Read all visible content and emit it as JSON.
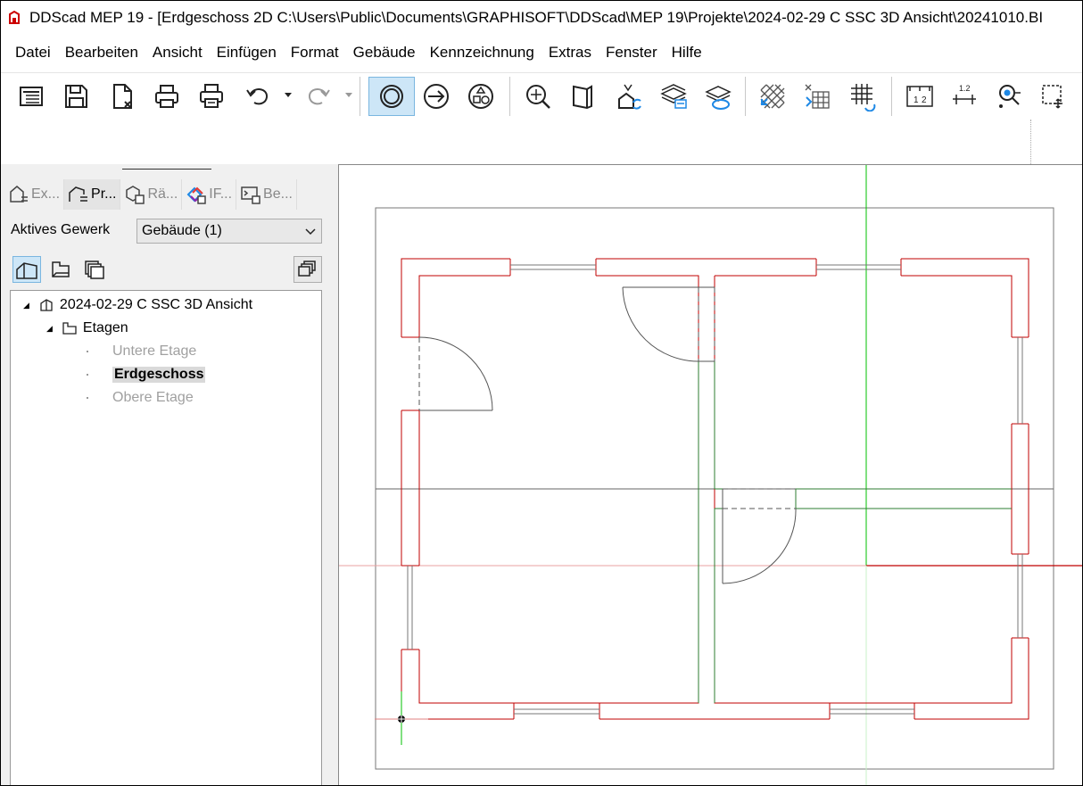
{
  "window": {
    "title": "DDScad MEP 19 - [Erdgeschoss  2D  C:\\Users\\Public\\Documents\\GRAPHISOFT\\DDScad\\MEP 19\\Projekte\\2024-02-29 C SSC 3D Ansicht\\20241010.BI"
  },
  "menu": [
    "Datei",
    "Bearbeiten",
    "Ansicht",
    "Einfügen",
    "Format",
    "Gebäude",
    "Kennzeichnung",
    "Extras",
    "Fenster",
    "Hilfe"
  ],
  "panel": {
    "tabs": [
      "Ex...",
      "Pr...",
      "Rä...",
      "IF...",
      "Be..."
    ],
    "gewerk_label": "Aktives Gewerk",
    "gewerk_value": "Gebäude (1)",
    "tree": {
      "project": "2024-02-29 C SSC 3D Ansicht",
      "folder": "Etagen",
      "floors": [
        "Untere Etage",
        "Erdgeschoss",
        "Obere Etage"
      ],
      "selected_floor": "Erdgeschoss"
    }
  },
  "toolbar": {
    "icons": [
      "properties-icon",
      "save-icon",
      "close-file-icon",
      "print-icon",
      "print-preview-icon",
      "undo-icon",
      "redo-icon",
      "select-mode-icon",
      "arrow-right-icon",
      "shapes-icon",
      "zoom-icon",
      "view-3d-icon",
      "building-sync-icon",
      "layers-icon",
      "layers-visible-icon",
      "hatch-icon",
      "grid-snap-icon",
      "grid-icon",
      "dimension-icon",
      "measure-icon",
      "point-snap-icon",
      "selection-icon"
    ]
  },
  "colors": {
    "wall_red": "#c00000",
    "wall_green": "#2e7d32",
    "axis_green": "#00c000",
    "axis_red": "#e08080",
    "accent": "#cde6f7"
  }
}
